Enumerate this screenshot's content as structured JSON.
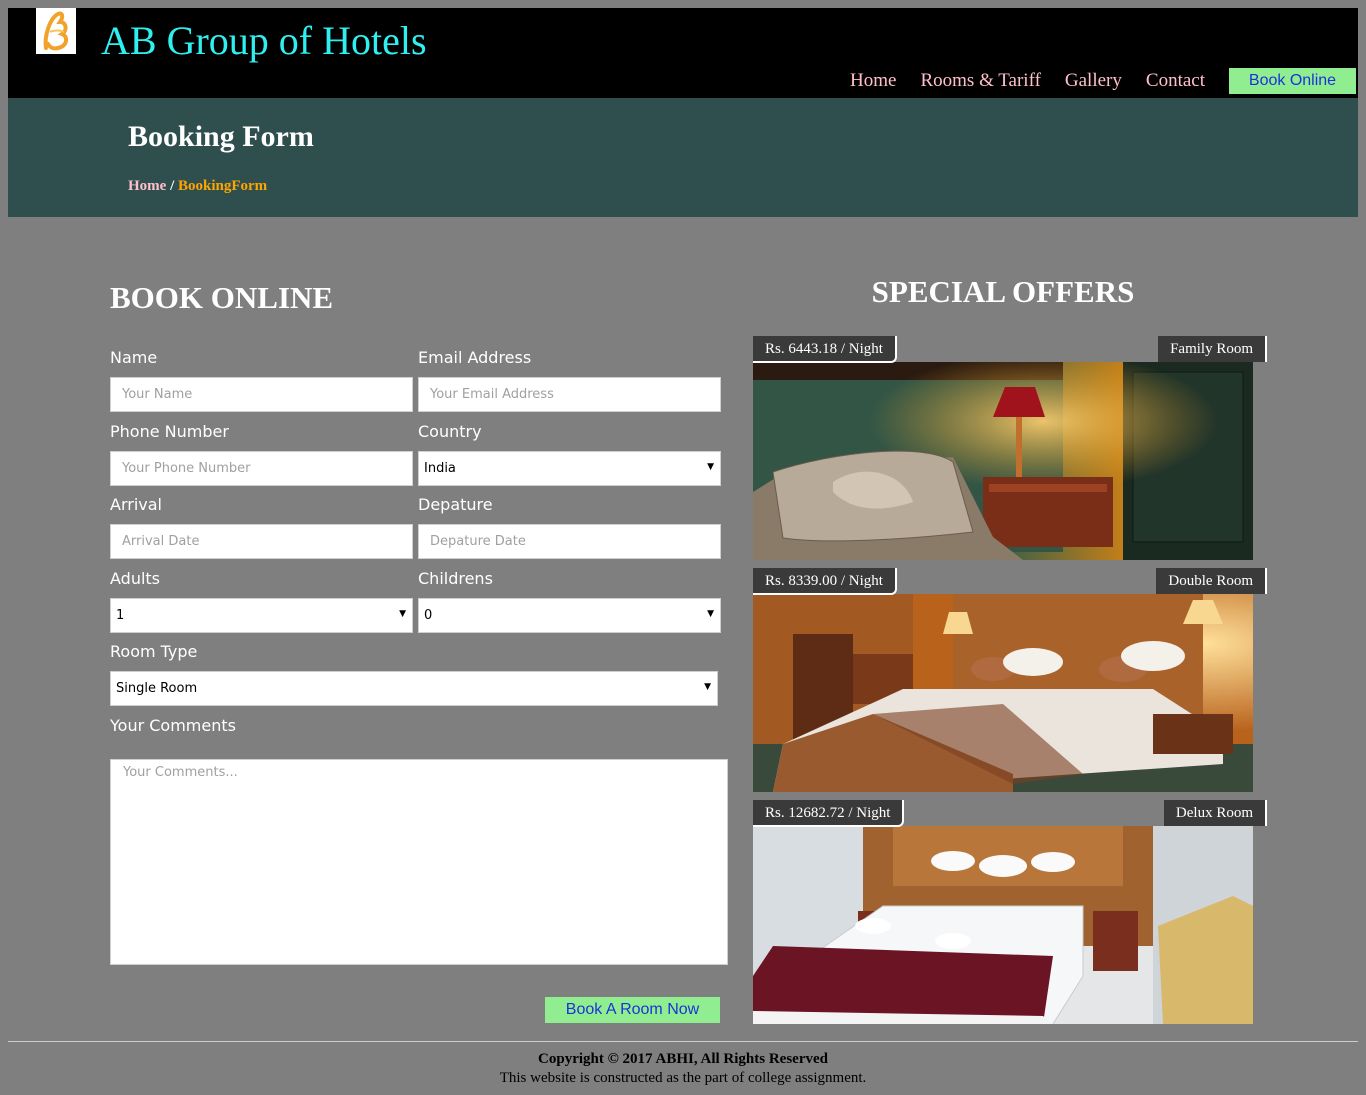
{
  "header": {
    "brand": "AB Group of Hotels",
    "nav": [
      "Home",
      "Rooms & Tariff",
      "Gallery",
      "Contact"
    ],
    "book_online": "Book Online"
  },
  "banner": {
    "title": "Booking Form",
    "breadcrumb_home": "Home",
    "breadcrumb_sep": " / ",
    "breadcrumb_current": "BookingForm"
  },
  "form": {
    "title": "BOOK ONLINE",
    "name_label": "Name",
    "name_placeholder": "Your Name",
    "email_label": "Email Address",
    "email_placeholder": "Your Email Address",
    "phone_label": "Phone Number",
    "phone_placeholder": "Your Phone Number",
    "country_label": "Country",
    "country_value": "India",
    "arrival_label": "Arrival",
    "arrival_placeholder": "Arrival Date",
    "departure_label": "Depature",
    "departure_placeholder": "Depature Date",
    "adults_label": "Adults",
    "adults_value": "1",
    "children_label": "Childrens",
    "children_value": "0",
    "room_type_label": "Room Type",
    "room_type_value": "Single Room",
    "comments_label": "Your Comments",
    "comments_placeholder": "Your Comments...",
    "submit": "Book A Room Now"
  },
  "offers": {
    "title": "SPECIAL OFFERS",
    "items": [
      {
        "price": "Rs. 6443.18 / Night",
        "room": "Family Room"
      },
      {
        "price": "Rs. 8339.00 / Night",
        "room": "Double Room"
      },
      {
        "price": "Rs. 12682.72 / Night",
        "room": "Delux Room"
      }
    ]
  },
  "footer": {
    "copyright": "Copyright © 2017 ABHI, All Rights Reserved",
    "note": "This website is constructed as the part of college assignment."
  },
  "colors": {
    "brand": "#2ff0f0",
    "nav_link": "#ffc0cb",
    "button_bg": "#90ee90",
    "button_text": "#1a33d9",
    "banner_bg": "#2f4f4f",
    "page_bg": "#7f7f7f",
    "breadcrumb_current": "#ffa500"
  }
}
